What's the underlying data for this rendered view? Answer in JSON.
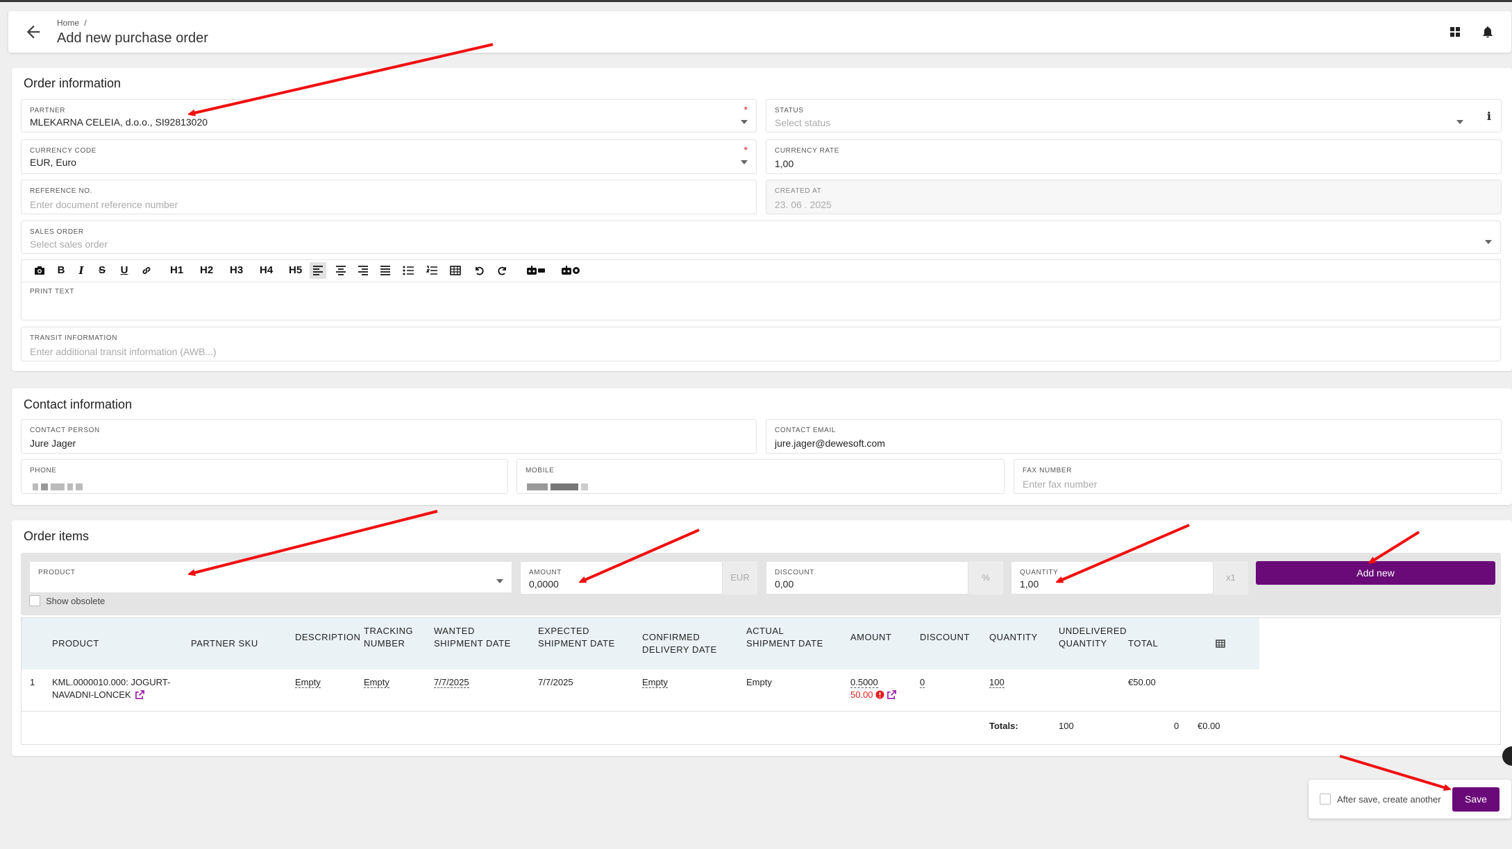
{
  "header": {
    "breadcrumb_home": "Home",
    "breadcrumb_sep": "/",
    "title": "Add new purchase order"
  },
  "order_info": {
    "title": "Order information",
    "partner": {
      "label": "PARTNER",
      "value": "MLEKARNA CELEIA, d.o.o., SI92813020",
      "required": "*"
    },
    "status": {
      "label": "STATUS",
      "placeholder": "Select status"
    },
    "currency_code": {
      "label": "CURRENCY CODE",
      "value": "EUR, Euro",
      "required": "*"
    },
    "currency_rate": {
      "label": "CURRENCY RATE",
      "value": "1,00"
    },
    "reference_no": {
      "label": "REFERENCE NO.",
      "placeholder": "Enter document reference number"
    },
    "created_at": {
      "label": "CREATED AT",
      "value": "23. 06 . 2025"
    },
    "sales_order": {
      "label": "SALES ORDER",
      "placeholder": "Select sales order"
    },
    "print_text": {
      "label": "PRINT TEXT"
    },
    "transit": {
      "label": "TRANSIT INFORMATION",
      "placeholder": "Enter additional transit information (AWB...)"
    },
    "toolbar": [
      "H1",
      "H2",
      "H3",
      "H4",
      "H5"
    ]
  },
  "contact_info": {
    "title": "Contact information",
    "contact_person": {
      "label": "CONTACT PERSON",
      "value": "Jure Jager"
    },
    "contact_email": {
      "label": "CONTACT EMAIL",
      "value": "jure.jager@dewesoft.com"
    },
    "phone": {
      "label": "PHONE"
    },
    "mobile": {
      "label": "MOBILE"
    },
    "fax": {
      "label": "FAX NUMBER",
      "placeholder": "Enter fax number"
    }
  },
  "order_items": {
    "title": "Order items",
    "product": {
      "label": "PRODUCT"
    },
    "amount": {
      "label": "AMOUNT",
      "value": "0,0000",
      "suffix": "EUR"
    },
    "discount": {
      "label": "DISCOUNT",
      "value": "0,00",
      "suffix": "%"
    },
    "quantity": {
      "label": "QUANTITY",
      "value": "1,00",
      "suffix": "x1"
    },
    "add_new": "Add new",
    "show_obsolete": "Show obsolete",
    "columns": {
      "product": "PRODUCT",
      "partner_sku": "PARTNER SKU",
      "description": "DESCRIPTION",
      "tracking_1": "TRACKING",
      "tracking_2": "NUMBER",
      "wanted_1": "WANTED",
      "wanted_2": "SHIPMENT DATE",
      "expected_1": "EXPECTED",
      "expected_2": "SHIPMENT DATE",
      "confirmed_1": "CONFIRMED",
      "confirmed_2": "DELIVERY DATE",
      "actual_1": "ACTUAL",
      "actual_2": "SHIPMENT DATE",
      "amount": "AMOUNT",
      "discount": "DISCOUNT",
      "quantity": "QUANTITY",
      "undelivered_1": "UNDELIVERED",
      "undelivered_2": "QUANTITY",
      "total": "TOTAL"
    },
    "row": {
      "index": "1",
      "product_1": "KML.0000010.000: JOGURT-",
      "product_2": "NAVADNI-LONCEK",
      "description": "Empty",
      "tracking": "Empty",
      "wanted": "7/7/2025",
      "expected": "7/7/2025",
      "confirmed": "Empty",
      "actual": "Empty",
      "amount": "0.5000",
      "amount_sub": "50.00",
      "discount": "0",
      "quantity": "100",
      "total": "€50.00"
    },
    "totals": {
      "label": "Totals:",
      "quantity": "100",
      "undelivered": "0",
      "total": "€0.00"
    }
  },
  "footer": {
    "after_save": "After save, create another",
    "save": "Save"
  },
  "colors": {
    "accent": "#6a0a78",
    "required": "#e02020",
    "annotation": "#f01010"
  }
}
